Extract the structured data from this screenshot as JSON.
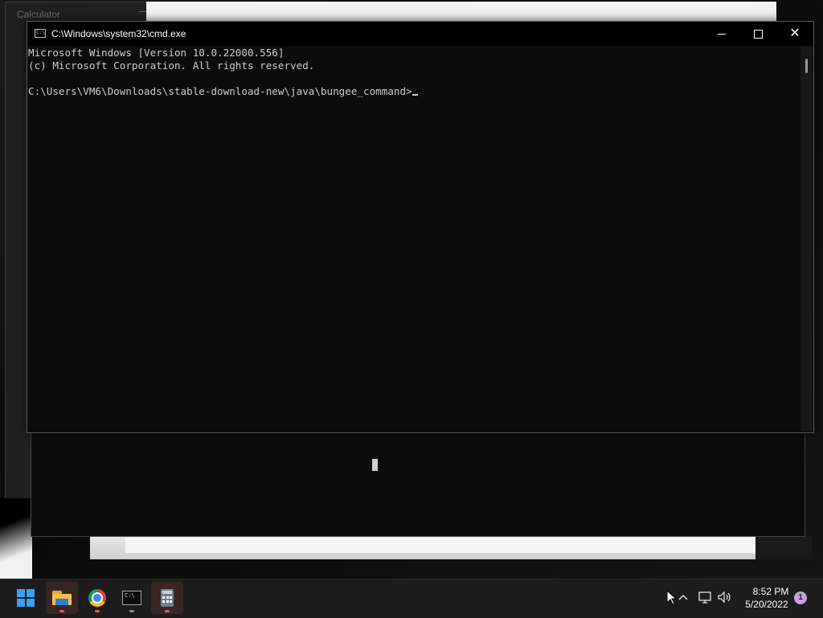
{
  "background_windows": {
    "calculator_title": "Calculator"
  },
  "cmd_window": {
    "title": "C:\\Windows\\system32\\cmd.exe",
    "icon_text": "C:\\",
    "lines": [
      "Microsoft Windows [Version 10.0.22000.556]",
      "(c) Microsoft Corporation. All rights reserved.",
      "",
      "C:\\Users\\VM6\\Downloads\\stable-download-new\\java\\bungee_command>"
    ]
  },
  "taskbar": {
    "apps": [
      {
        "name": "start",
        "icon": "windows-logo-icon"
      },
      {
        "name": "file-explorer",
        "icon": "folder-icon"
      },
      {
        "name": "chrome",
        "icon": "chrome-icon"
      },
      {
        "name": "command-prompt",
        "icon": "terminal-icon"
      },
      {
        "name": "calculator",
        "icon": "calculator-icon"
      }
    ],
    "clock": {
      "time": "8:52 PM",
      "date": "5/20/2022"
    },
    "notification_count": "1"
  },
  "colors": {
    "console_bg": "#0c0c0c",
    "console_text": "#cccccc",
    "taskbar_bg": "#1c1c1c",
    "start_blue": "#3aa0f0"
  }
}
